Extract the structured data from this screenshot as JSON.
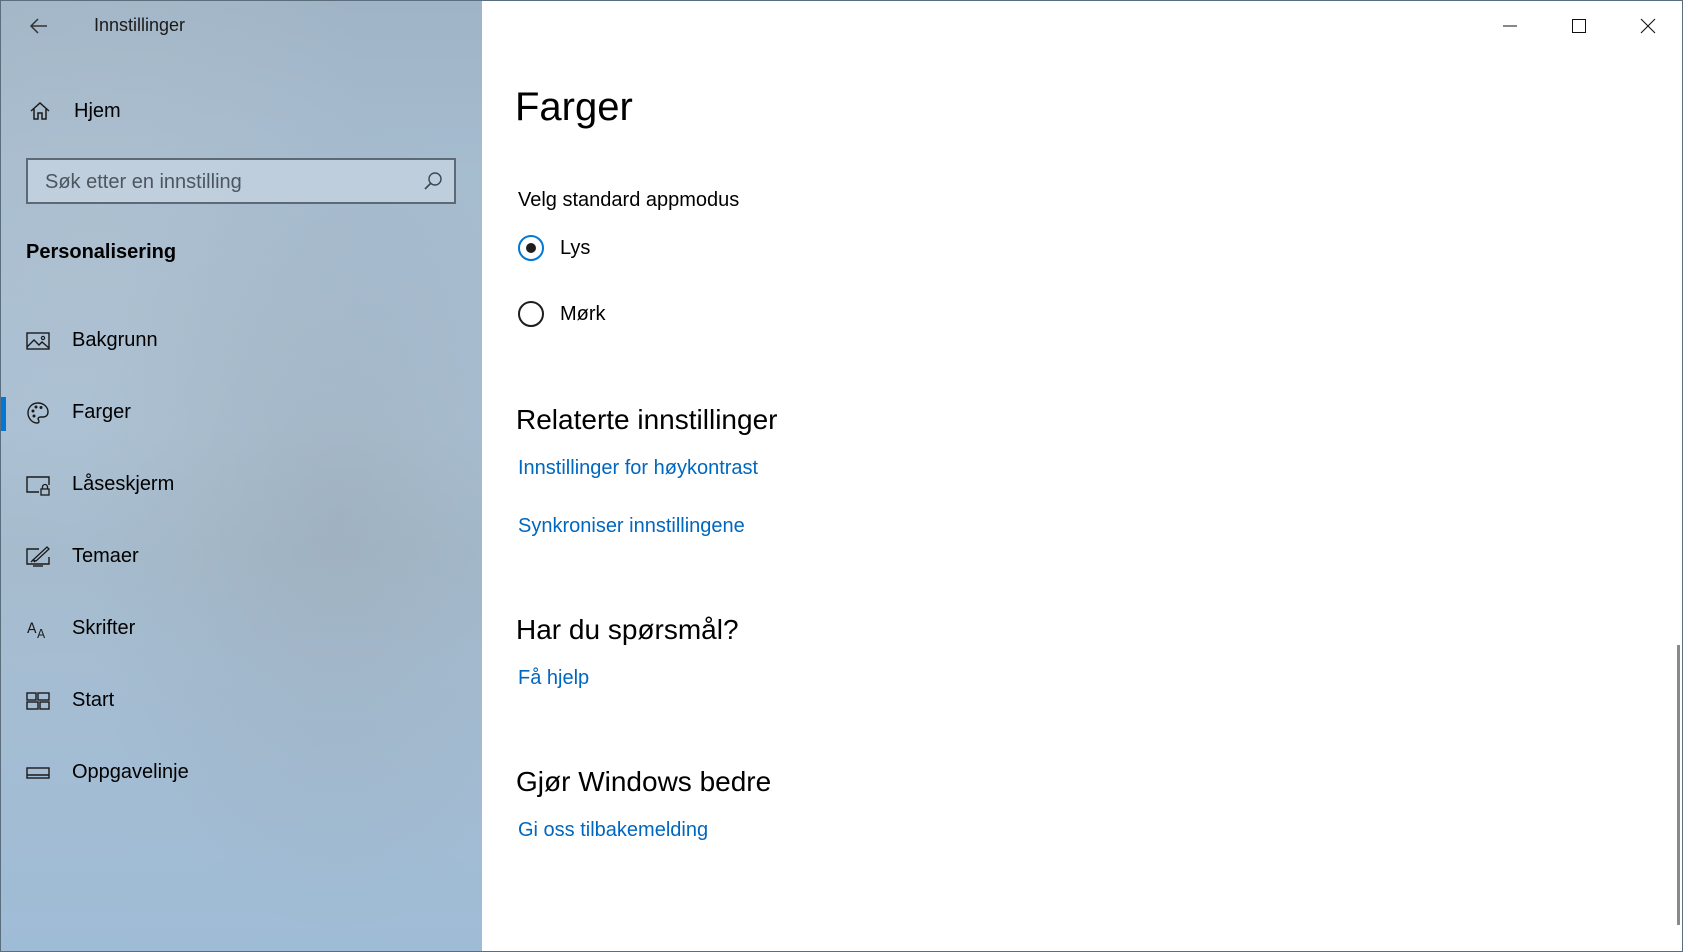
{
  "window": {
    "title": "Innstillinger"
  },
  "sidebar": {
    "home_label": "Hjem",
    "search_placeholder": "Søk etter en innstilling",
    "section_title": "Personalisering",
    "items": [
      {
        "label": "Bakgrunn",
        "icon": "picture-icon",
        "selected": false
      },
      {
        "label": "Farger",
        "icon": "palette-icon",
        "selected": true
      },
      {
        "label": "Låseskjerm",
        "icon": "lock-screen-icon",
        "selected": false
      },
      {
        "label": "Temaer",
        "icon": "themes-icon",
        "selected": false
      },
      {
        "label": "Skrifter",
        "icon": "fonts-icon",
        "selected": false
      },
      {
        "label": "Start",
        "icon": "start-icon",
        "selected": false
      },
      {
        "label": "Oppgavelinje",
        "icon": "taskbar-icon",
        "selected": false
      }
    ]
  },
  "main": {
    "page_title": "Farger",
    "app_mode": {
      "label": "Velg standard appmodus",
      "options": [
        {
          "label": "Lys",
          "checked": true
        },
        {
          "label": "Mørk",
          "checked": false
        }
      ]
    },
    "related": {
      "heading": "Relaterte innstillinger",
      "links": [
        "Innstillinger for høykontrast",
        "Synkroniser innstillingene"
      ]
    },
    "questions": {
      "heading": "Har du spørsmål?",
      "link": "Få hjelp"
    },
    "feedback": {
      "heading": "Gjør Windows bedre",
      "link": "Gi oss tilbakemelding"
    }
  },
  "colors": {
    "accent": "#0078d4",
    "link": "#0067c0"
  }
}
